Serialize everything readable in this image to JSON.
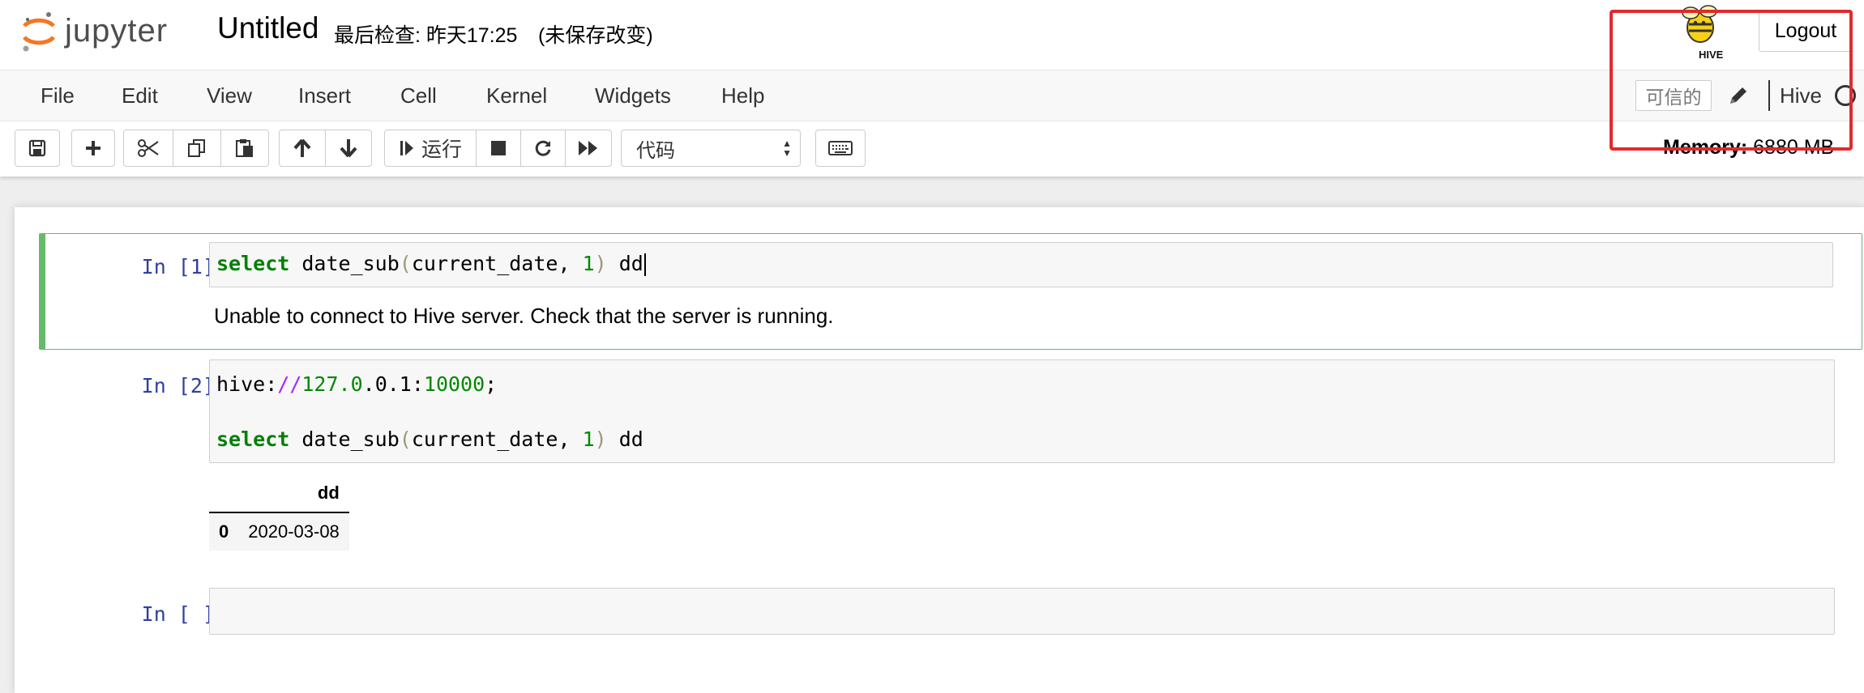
{
  "header": {
    "logo_text": "jupyter",
    "notebook_name": "Untitled",
    "checkpoint": "最后检查: 昨天17:25",
    "autosave": "(未保存改变)",
    "logout_label": "Logout"
  },
  "menubar": {
    "items": [
      "File",
      "Edit",
      "View",
      "Insert",
      "Cell",
      "Kernel",
      "Widgets",
      "Help"
    ],
    "trusted_label": "可信的",
    "kernel_name": "Hive"
  },
  "toolbar": {
    "run_label": "运行",
    "cell_type": "代码",
    "memory_label": "Memory:",
    "memory_value": "6880 MB"
  },
  "colors": {
    "selected_cell_border": "#66bb6a",
    "prompt": "#303f9f",
    "keyword": "#008000",
    "annotation": "#e02b2b"
  },
  "cells": [
    {
      "prompt": "In [1]:",
      "code": {
        "kw": "select",
        "fn": " date_sub",
        "open": "(",
        "arg": "current_date, ",
        "num": "1",
        "close": ")",
        "alias": " dd"
      },
      "output": "Unable to connect to Hive server. Check that the server is running."
    },
    {
      "prompt": "In [2]:",
      "code_line1": {
        "scheme": "hive:",
        "slashes": "//",
        "ip1": "127.0",
        "ip2": ".0.1:",
        "port": "10000",
        "end": ";"
      },
      "code_line2": {
        "kw": "select",
        "fn": " date_sub",
        "open": "(",
        "arg": "current_date, ",
        "num": "1",
        "close": ")",
        "alias": " dd"
      },
      "table": {
        "columns": [
          "",
          "dd"
        ],
        "rows": [
          {
            "index": "0",
            "dd": "2020-03-08"
          }
        ]
      }
    },
    {
      "prompt": "In [ ]:"
    }
  ]
}
